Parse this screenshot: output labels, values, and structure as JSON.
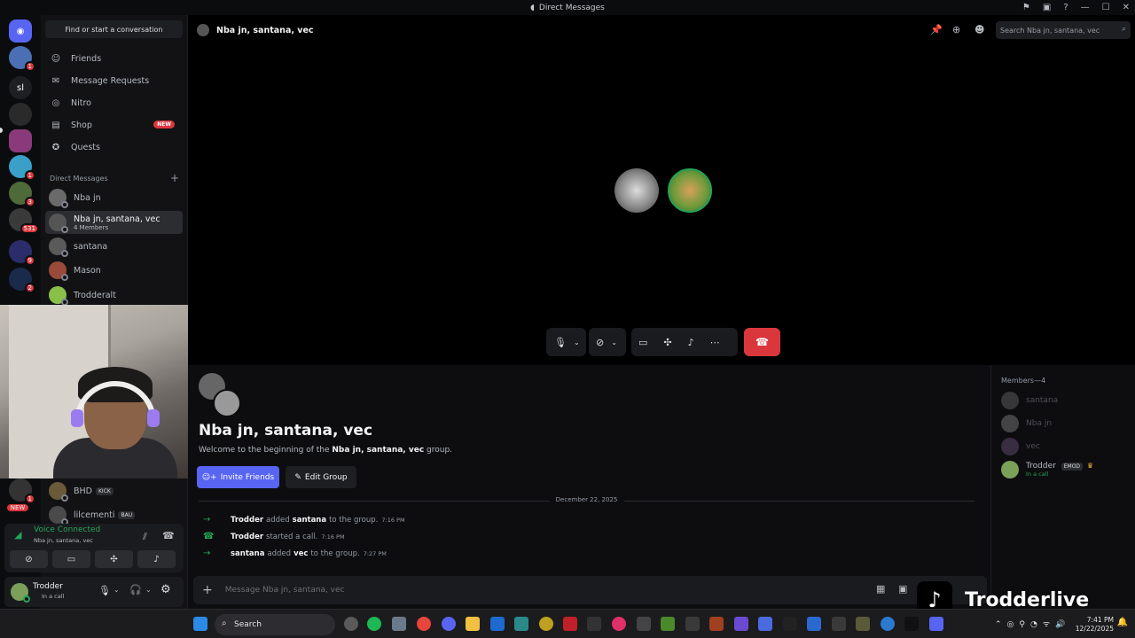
{
  "titlebar": {
    "title": "Direct Messages"
  },
  "server_rail": {
    "text_server": "sl",
    "badges": [
      "1",
      "1",
      "3",
      "531",
      "9",
      "2",
      "1",
      "NEW"
    ]
  },
  "dm_sidebar": {
    "find_button": "Find or start a conversation",
    "nav": [
      {
        "label": "Friends",
        "icon": "friends-icon"
      },
      {
        "label": "Message Requests",
        "icon": "message-requests-icon"
      },
      {
        "label": "Nitro",
        "icon": "nitro-icon"
      },
      {
        "label": "Shop",
        "icon": "shop-icon",
        "badge": "NEW"
      },
      {
        "label": "Quests",
        "icon": "quests-icon"
      }
    ],
    "dm_header": "Direct Messages",
    "dms": [
      {
        "name": "Nba jn"
      },
      {
        "name": "Nba jn, santana, vec",
        "sub": "4 Members",
        "active": true
      },
      {
        "name": "santana"
      },
      {
        "name": "Mason"
      },
      {
        "name": "Trodderalt"
      }
    ],
    "lower_dms": [
      {
        "name": "BHD",
        "tag": "KICK"
      },
      {
        "name": "lilcementi",
        "tag": "BAU"
      }
    ]
  },
  "voice": {
    "status": "Voice Connected",
    "channel": "Nba jn, santana, vec"
  },
  "user": {
    "name": "Trodder",
    "status": "In a call"
  },
  "chat": {
    "title": "Nba jn, santana, vec",
    "search_placeholder": "Search Nba jn, santana, vec",
    "group_name": "Nba jn, santana, vec",
    "welcome_prefix": "Welcome to the beginning of the",
    "welcome_group": "Nba jn, santana, vec",
    "welcome_suffix": "group.",
    "invite_label": "Invite Friends",
    "edit_label": "Edit Group",
    "date": "December 22, 2025",
    "messages": [
      {
        "actor": "Trodder",
        "action": "added",
        "target": "santana",
        "rest": "to the group.",
        "time": "7:16 PM"
      },
      {
        "actor": "Trodder",
        "action": "started a call.",
        "target": "",
        "rest": "",
        "time": "7:16 PM"
      },
      {
        "actor": "santana",
        "action": "added",
        "target": "vec",
        "rest": "to the group.",
        "time": "7:27 PM"
      }
    ],
    "composer_placeholder": "Message Nba jn, santana, vec"
  },
  "members": {
    "header": "Members—4",
    "list": [
      {
        "name": "santana"
      },
      {
        "name": "Nba jn"
      },
      {
        "name": "vec"
      },
      {
        "name": "Trodder",
        "tag": "EMOD",
        "status": "In a call"
      }
    ]
  },
  "taskbar": {
    "search": "Search",
    "time": "7:41 PM",
    "date": "12/22/2025"
  },
  "overlay": {
    "tiktok_name": "Trodderlive"
  },
  "colors": {
    "accent": "#5865f2",
    "danger": "#da373c",
    "online": "#23a55a"
  }
}
